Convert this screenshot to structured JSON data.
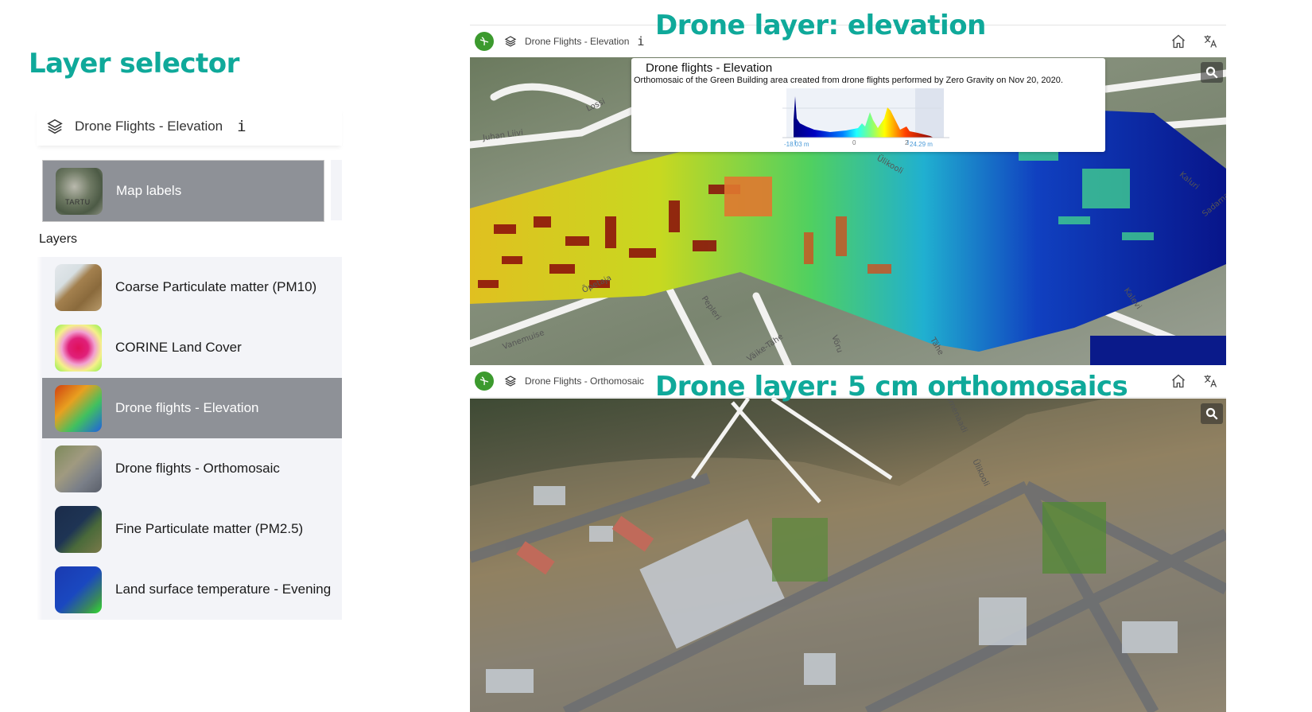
{
  "captions": {
    "left": "Layer selector",
    "top": "Drone layer: elevation",
    "bottom": "Drone layer: 5 cm orthomosaics"
  },
  "layer_selector": {
    "header": {
      "icon": "layers-icon",
      "title": "Drone Flights - Elevation",
      "info_icon": "i"
    },
    "basemap": {
      "label": "Map labels",
      "thumb_text": "TARTU",
      "selected": true
    },
    "layers_heading": "Layers",
    "layers": [
      {
        "label": "Coarse Particulate matter (PM10)",
        "selected": false
      },
      {
        "label": "CORINE Land Cover",
        "selected": false
      },
      {
        "label": "Drone flights - Elevation",
        "selected": true
      },
      {
        "label": "Drone flights - Orthomosaic",
        "selected": false
      },
      {
        "label": "Fine Particulate matter (PM2.5)",
        "selected": false
      },
      {
        "label": "Land surface temperature - Evening",
        "selected": false
      }
    ]
  },
  "elevation_view": {
    "toolbar": {
      "layer_title": "Drone Flights - Elevation",
      "info_icon": "i",
      "home_icon": "home-icon",
      "translate_icon": "translate-icon"
    },
    "popup": {
      "title": "Drone flights - Elevation",
      "description": "Orthomosaic of the Green Building area created from drone flights performed by Zero Gravity on Nov 20, 2020.",
      "histogram": {
        "min_label": "-18.03 m",
        "zero_label": "0",
        "partial_label": "2",
        "max_label": "24.29 m"
      }
    },
    "street_labels": [
      "Juhan Liivi",
      "Lossi",
      "Ülikooli",
      "Kalevi",
      "Kaluri",
      "Sadama",
      "Õpetaja",
      "Vanemuise",
      "Pepleri",
      "Väike-Tähe",
      "Vöru",
      "Tähe"
    ]
  },
  "ortho_view": {
    "toolbar": {
      "layer_title": "Drone Flights - Orthomosaic",
      "home_icon": "home-icon",
      "translate_icon": "translate-icon"
    },
    "street_labels": [
      "Promenaadi",
      "Ülikooli"
    ]
  },
  "colors": {
    "caption": "#0fa99a",
    "selected_row": "#8e9197",
    "list_bg": "#f3f4f8",
    "logo": "#3c9a2e"
  }
}
